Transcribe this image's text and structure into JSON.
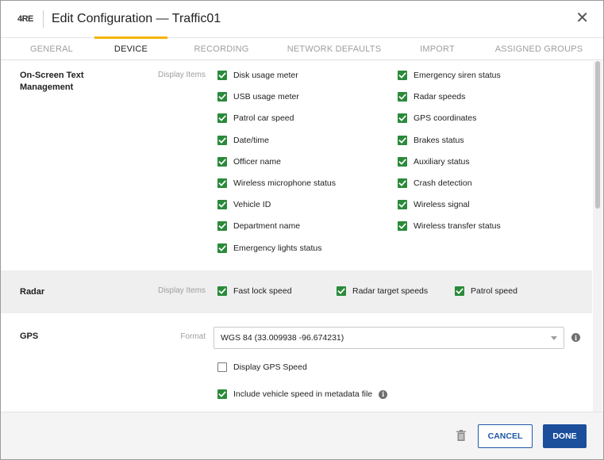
{
  "header": {
    "logo": "4RE",
    "title": "Edit Configuration — Traffic01"
  },
  "tabs": [
    {
      "label": "GENERAL",
      "active": false
    },
    {
      "label": "DEVICE",
      "active": true
    },
    {
      "label": "RECORDING",
      "active": false
    },
    {
      "label": "NETWORK DEFAULTS",
      "active": false
    },
    {
      "label": "IMPORT",
      "active": false
    },
    {
      "label": "ASSIGNED GROUPS",
      "active": false
    }
  ],
  "onscreen": {
    "title": "On-Screen Text Management",
    "label": "Display Items",
    "col1": [
      {
        "label": "Disk usage meter",
        "checked": true
      },
      {
        "label": "USB usage meter",
        "checked": true
      },
      {
        "label": "Patrol car speed",
        "checked": true
      },
      {
        "label": "Date/time",
        "checked": true
      },
      {
        "label": "Officer name",
        "checked": true
      },
      {
        "label": "Wireless microphone status",
        "checked": true
      },
      {
        "label": "Vehicle ID",
        "checked": true
      },
      {
        "label": "Department name",
        "checked": true
      },
      {
        "label": "Emergency lights status",
        "checked": true
      }
    ],
    "col2": [
      {
        "label": "Emergency siren status",
        "checked": true
      },
      {
        "label": "Radar speeds",
        "checked": true
      },
      {
        "label": "GPS coordinates",
        "checked": true
      },
      {
        "label": "Brakes status",
        "checked": true
      },
      {
        "label": "Auxiliary status",
        "checked": true
      },
      {
        "label": "Crash detection",
        "checked": true
      },
      {
        "label": "Wireless signal",
        "checked": true
      },
      {
        "label": "Wireless transfer status",
        "checked": true
      }
    ]
  },
  "radar": {
    "title": "Radar",
    "label": "Display Items",
    "items": [
      {
        "label": "Fast lock speed",
        "checked": true
      },
      {
        "label": "Radar target speeds",
        "checked": true
      },
      {
        "label": "Patrol speed",
        "checked": true
      }
    ]
  },
  "gps": {
    "title": "GPS",
    "format_label": "Format",
    "format_value": "WGS 84 (33.009938 -96.674231)",
    "options": [
      {
        "label": "Display GPS Speed",
        "checked": false
      },
      {
        "label": "Include vehicle speed in metadata file",
        "checked": true
      }
    ]
  },
  "footer": {
    "cancel": "CANCEL",
    "done": "DONE"
  },
  "colors": {
    "accent_tab": "#f5b400",
    "checkbox": "#2a8a3a",
    "primary": "#1b4f9c"
  }
}
